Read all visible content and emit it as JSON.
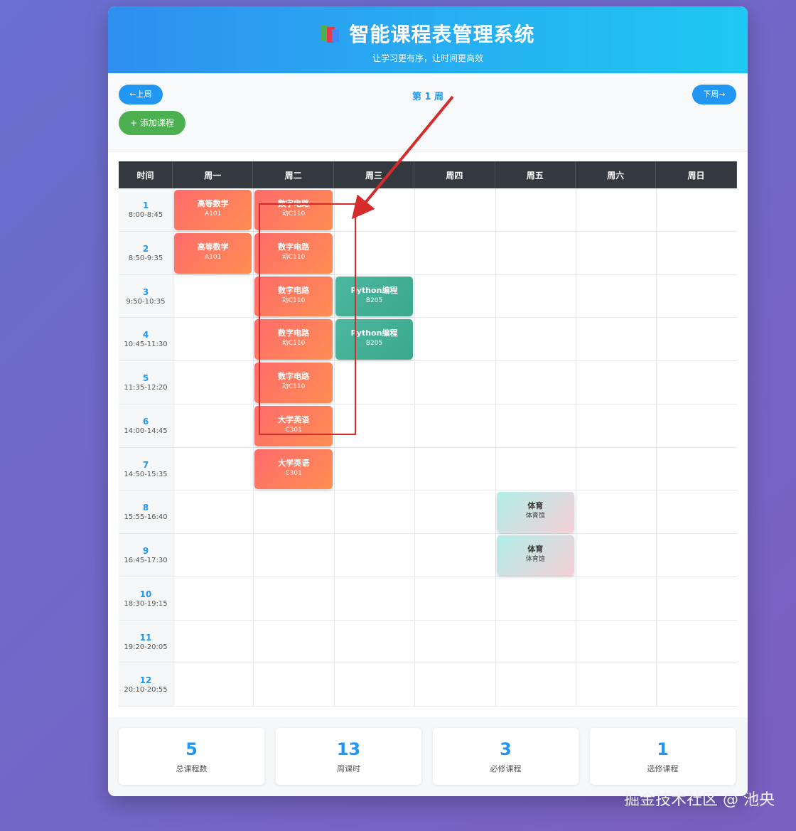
{
  "header": {
    "title": "智能课程表管理系统",
    "subtitle": "让学习更有序，让时间更高效"
  },
  "toolbar": {
    "prev_label": "←上周",
    "next_label": "下周→",
    "week_label": "第 1 周",
    "add_label": "+ 添加课程"
  },
  "table": {
    "time_header": "时间",
    "days": [
      "周一",
      "周二",
      "周三",
      "周四",
      "周五",
      "周六",
      "周日"
    ],
    "periods": [
      {
        "num": "1",
        "time": "8:00-8:45"
      },
      {
        "num": "2",
        "time": "8:50-9:35"
      },
      {
        "num": "3",
        "time": "9:50-10:35"
      },
      {
        "num": "4",
        "time": "10:45-11:30"
      },
      {
        "num": "5",
        "time": "11:35-12:20"
      },
      {
        "num": "6",
        "time": "14:00-14:45"
      },
      {
        "num": "7",
        "time": "14:50-15:35"
      },
      {
        "num": "8",
        "time": "15:55-16:40"
      },
      {
        "num": "9",
        "time": "16:45-17:30"
      },
      {
        "num": "10",
        "time": "18:30-19:15"
      },
      {
        "num": "11",
        "time": "19:20-20:05"
      },
      {
        "num": "12",
        "time": "20:10-20:55"
      }
    ],
    "courses": [
      {
        "day": 0,
        "period": 0,
        "name": "高等数学",
        "room": "A101",
        "style": "orange"
      },
      {
        "day": 0,
        "period": 1,
        "name": "高等数学",
        "room": "A101",
        "style": "orange"
      },
      {
        "day": 1,
        "period": 0,
        "name": "数字电路",
        "room": "动C110",
        "style": "orange"
      },
      {
        "day": 1,
        "period": 1,
        "name": "数字电路",
        "room": "动C110",
        "style": "orange"
      },
      {
        "day": 1,
        "period": 2,
        "name": "数字电路",
        "room": "动C110",
        "style": "orange"
      },
      {
        "day": 1,
        "period": 3,
        "name": "数字电路",
        "room": "动C110",
        "style": "orange"
      },
      {
        "day": 1,
        "period": 4,
        "name": "数字电路",
        "room": "动C110",
        "style": "orange"
      },
      {
        "day": 1,
        "period": 5,
        "name": "大学英语",
        "room": "C301",
        "style": "orange"
      },
      {
        "day": 1,
        "period": 6,
        "name": "大学英语",
        "room": "C301",
        "style": "orange"
      },
      {
        "day": 2,
        "period": 2,
        "name": "Python编程",
        "room": "B205",
        "style": "teal"
      },
      {
        "day": 2,
        "period": 3,
        "name": "Python编程",
        "room": "B205",
        "style": "teal"
      },
      {
        "day": 4,
        "period": 7,
        "name": "体育",
        "room": "体育馆",
        "style": "pe"
      },
      {
        "day": 4,
        "period": 8,
        "name": "体育",
        "room": "体育馆",
        "style": "pe"
      }
    ]
  },
  "stats": [
    {
      "value": "5",
      "label": "总课程数"
    },
    {
      "value": "13",
      "label": "周课时"
    },
    {
      "value": "3",
      "label": "必修课程"
    },
    {
      "value": "1",
      "label": "选修课程"
    }
  ],
  "watermark": "掘金技术社区 @ 池央",
  "colors": {
    "accent": "#2196f3",
    "add_button": "#4caf50",
    "header_dark": "#34393f",
    "annotation": "#d62b2b"
  }
}
